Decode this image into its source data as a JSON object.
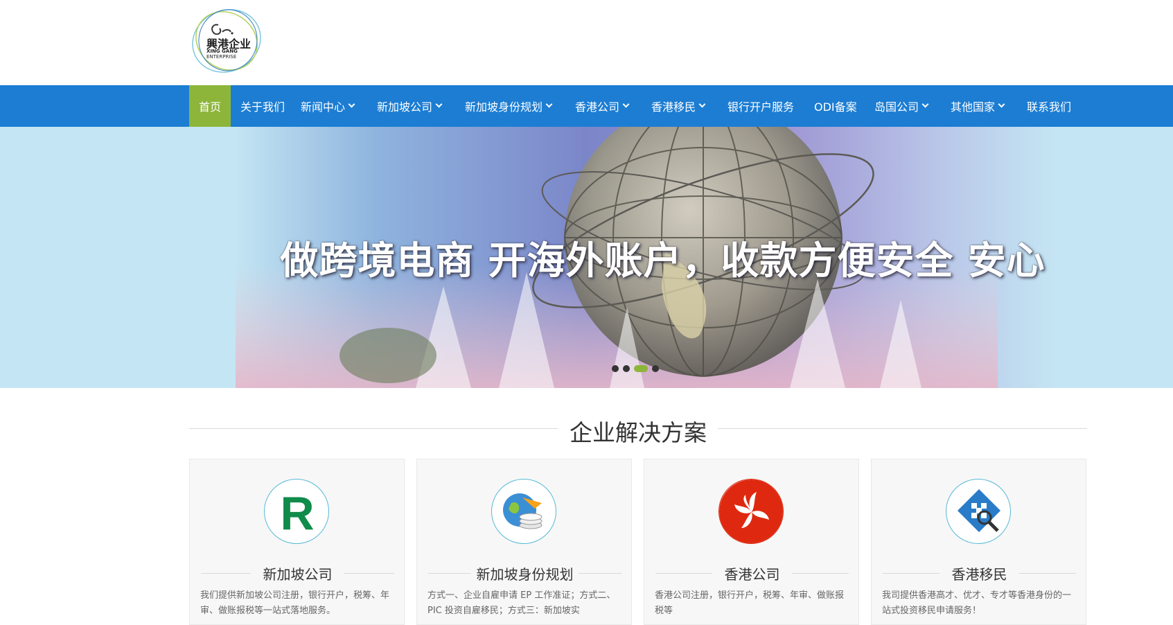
{
  "logo": {
    "brand_cn": "興港企业",
    "brand_en_line1": "XING GANG",
    "brand_en_line2": "ENTERPRISE"
  },
  "nav": {
    "items": [
      {
        "label": "首页",
        "active": true,
        "dropdown": false
      },
      {
        "label": "关于我们",
        "active": false,
        "dropdown": false
      },
      {
        "label": "新闻中心",
        "active": false,
        "dropdown": true
      },
      {
        "label": "新加坡公司",
        "active": false,
        "dropdown": true
      },
      {
        "label": "新加坡身份规划",
        "active": false,
        "dropdown": true
      },
      {
        "label": "香港公司",
        "active": false,
        "dropdown": true
      },
      {
        "label": "香港移民",
        "active": false,
        "dropdown": true
      },
      {
        "label": "银行开户服务",
        "active": false,
        "dropdown": false
      },
      {
        "label": "ODI备案",
        "active": false,
        "dropdown": false
      },
      {
        "label": "岛国公司",
        "active": false,
        "dropdown": true
      },
      {
        "label": "其他国家",
        "active": false,
        "dropdown": true
      },
      {
        "label": "联系我们",
        "active": false,
        "dropdown": false
      }
    ]
  },
  "banner": {
    "headline": "做跨境电商 开海外账户，收款方便安全 安心",
    "slide_count": 4,
    "active_slide": 3
  },
  "section": {
    "title": "企业解决方案"
  },
  "cards": [
    {
      "title": "新加坡公司",
      "icon": "registered-r-icon",
      "desc": "我们提供新加坡公司注册，银行开户，税筹、年审、做账报税等一站式落地服务。"
    },
    {
      "title": "新加坡身份规划",
      "icon": "globe-coins-icon",
      "desc": "方式一、企业自雇申请 EP 工作准证；方式二、PIC 投资自雇移民；方式三：新加坡实"
    },
    {
      "title": "香港公司",
      "icon": "hong-kong-flag-icon",
      "desc": "香港公司注册，银行开户，税筹、年审、做账报税等"
    },
    {
      "title": "香港移民",
      "icon": "magnifier-diamond-icon",
      "desc": "我司提供香港高才、优才、专才等香港身份的一站式投资移民申请服务！"
    }
  ],
  "colors": {
    "nav_bg": "#1c7dd3",
    "active_accent": "#8db53a"
  }
}
